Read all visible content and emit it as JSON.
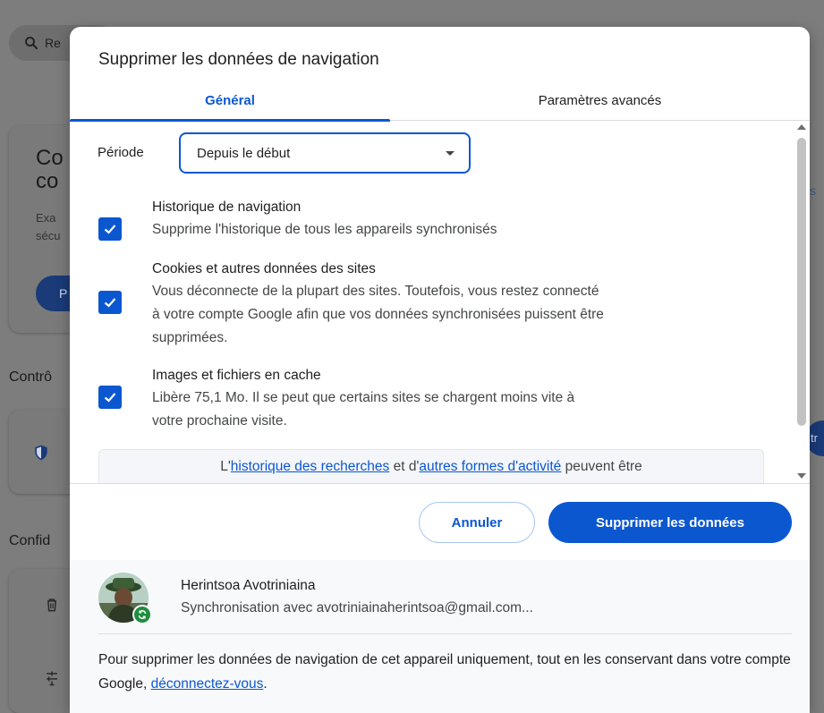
{
  "background": {
    "search_placeholder": "Re",
    "card_title_lines": [
      "Co",
      "co"
    ],
    "card_text_lines": [
      "Exa",
      "sécu"
    ],
    "card_button_label": "P",
    "section_controls": "Contrô",
    "section_confidentiality": "Confid",
    "right_button_label": "tr"
  },
  "dialog": {
    "title": "Supprimer les données de navigation",
    "tabs": {
      "general": "Général",
      "advanced": "Paramètres avancés"
    },
    "period": {
      "label": "Période",
      "selected": "Depuis le début"
    },
    "options": [
      {
        "title": "Historique de navigation",
        "desc_lines": [
          "Supprime l'historique de tous les appareils synchronisés"
        ],
        "checked": true
      },
      {
        "title": "Cookies et autres données des sites",
        "desc_lines": [
          "Vous déconnecte de la plupart des sites. Toutefois, vous restez connecté",
          "à votre compte Google afin que vos données synchronisées puissent être",
          "supprimées."
        ],
        "checked": true
      },
      {
        "title": "Images et fichiers en cache",
        "desc_lines": [
          "Libère 75,1 Mo. Il se peut que certains sites se chargent moins vite à",
          "votre prochaine visite."
        ],
        "checked": true
      }
    ],
    "info": {
      "prefix": "L'",
      "link1": "historique des recherches",
      "middle": " et d'",
      "link2": "autres formes d'activité",
      "suffix": " peuvent être"
    },
    "buttons": {
      "cancel": "Annuler",
      "delete": "Supprimer les données"
    },
    "account": {
      "name": "Herintsoa Avotriniaina",
      "sync_text": "Synchronisation avec avotriniainaherintsoa@gmail.com...",
      "note_text": "Pour supprimer les données de navigation de cet appareil uniquement, tout en les conservant dans votre compte Google, ",
      "note_link": "déconnectez-vous",
      "note_end": "."
    }
  },
  "colors": {
    "accent": "#0b57d0",
    "sync_badge": "#1e8e3e"
  }
}
